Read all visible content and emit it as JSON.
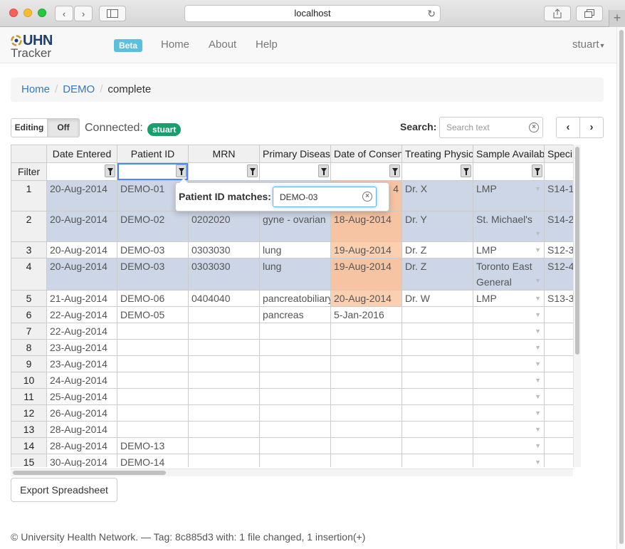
{
  "browser": {
    "url": "localhost"
  },
  "navbar": {
    "logo_top": "UHN",
    "logo_bottom": "Tracker",
    "beta_badge": "Beta",
    "links": [
      "Home",
      "About",
      "Help"
    ],
    "user": "stuart"
  },
  "breadcrumb": {
    "items": [
      "Home",
      "DEMO"
    ],
    "current": "complete"
  },
  "toolbar": {
    "editing_label": "Editing",
    "editing_value": "Off",
    "connected_label": "Connected:",
    "connected_user": "stuart",
    "search_label": "Search:",
    "search_placeholder": "Search text"
  },
  "grid": {
    "columns": [
      "Date Entered",
      "Patient ID",
      "MRN",
      "Primary Disease",
      "Date of Consent",
      "Treating Physician",
      "Sample Available",
      "Specimen"
    ],
    "filter_label": "Filter",
    "rows": [
      {
        "n": "1",
        "date": "20-Aug-2014",
        "pid": "DEMO-01",
        "mrn": "",
        "disease": "",
        "consent": "4",
        "phys": "Dr. X",
        "sample": "LMP",
        "spec": "S14-1"
      },
      {
        "n": "2",
        "date": "20-Aug-2014",
        "pid": "DEMO-02",
        "mrn": "0202020",
        "disease": "gyne - ovarian",
        "consent": "18-Aug-2014",
        "phys": "Dr. Y",
        "sample": "St. Michael's",
        "spec": "S14-2"
      },
      {
        "n": "3",
        "date": "20-Aug-2014",
        "pid": "DEMO-03",
        "mrn": "0303030",
        "disease": "lung",
        "consent": "19-Aug-2014",
        "phys": "Dr. Z",
        "sample": "LMP",
        "spec": "S12-3"
      },
      {
        "n": "4",
        "date": "20-Aug-2014",
        "pid": "DEMO-03",
        "mrn": "0303030",
        "disease": "lung",
        "consent": "19-Aug-2014",
        "phys": "Dr. Z",
        "sample": "Toronto East General",
        "spec": "S12-4"
      },
      {
        "n": "5",
        "date": "21-Aug-2014",
        "pid": "DEMO-06",
        "mrn": "0404040",
        "disease": "pancreatobiliary",
        "consent": "20-Aug-2014",
        "phys": "Dr. W",
        "sample": "LMP",
        "spec": "S13-3"
      },
      {
        "n": "6",
        "date": "22-Aug-2014",
        "pid": "DEMO-05",
        "mrn": "",
        "disease": "pancreas",
        "consent": "5-Jan-2016",
        "phys": "",
        "sample": "",
        "spec": ""
      },
      {
        "n": "7",
        "date": "22-Aug-2014",
        "pid": "",
        "mrn": "",
        "disease": "",
        "consent": "",
        "phys": "",
        "sample": "",
        "spec": ""
      },
      {
        "n": "8",
        "date": "23-Aug-2014",
        "pid": "",
        "mrn": "",
        "disease": "",
        "consent": "",
        "phys": "",
        "sample": "",
        "spec": ""
      },
      {
        "n": "9",
        "date": "23-Aug-2014",
        "pid": "",
        "mrn": "",
        "disease": "",
        "consent": "",
        "phys": "",
        "sample": "",
        "spec": ""
      },
      {
        "n": "10",
        "date": "24-Aug-2014",
        "pid": "",
        "mrn": "",
        "disease": "",
        "consent": "",
        "phys": "",
        "sample": "",
        "spec": ""
      },
      {
        "n": "11",
        "date": "25-Aug-2014",
        "pid": "",
        "mrn": "",
        "disease": "",
        "consent": "",
        "phys": "",
        "sample": "",
        "spec": ""
      },
      {
        "n": "12",
        "date": "26-Aug-2014",
        "pid": "",
        "mrn": "",
        "disease": "",
        "consent": "",
        "phys": "",
        "sample": "",
        "spec": ""
      },
      {
        "n": "13",
        "date": "28-Aug-2014",
        "pid": "",
        "mrn": "",
        "disease": "",
        "consent": "",
        "phys": "",
        "sample": "",
        "spec": ""
      },
      {
        "n": "14",
        "date": "28-Aug-2014",
        "pid": "DEMO-13",
        "mrn": "",
        "disease": "",
        "consent": "",
        "phys": "",
        "sample": "",
        "spec": ""
      },
      {
        "n": "15",
        "date": "30-Aug-2014",
        "pid": "DEMO-14",
        "mrn": "",
        "disease": "",
        "consent": "",
        "phys": "",
        "sample": "",
        "spec": ""
      }
    ],
    "selected_rows": [
      "1",
      "2",
      "4"
    ],
    "consent_highlight_rows": [
      "1",
      "2",
      "3",
      "4",
      "5"
    ]
  },
  "filter_popover": {
    "label": "Patient ID matches:",
    "value": "DEMO-03"
  },
  "export_button": "Export Spreadsheet",
  "footer": "© University Health Network. — Tag: 8c885d3 with: 1 file changed, 1 insertion(+)",
  "colors": {
    "selected_row": "#ccd6e6",
    "consent_highlight": "#fbd0b0",
    "connected_badge": "#1a9e6c",
    "beta_badge": "#5bc0de",
    "link": "#337ab7"
  }
}
